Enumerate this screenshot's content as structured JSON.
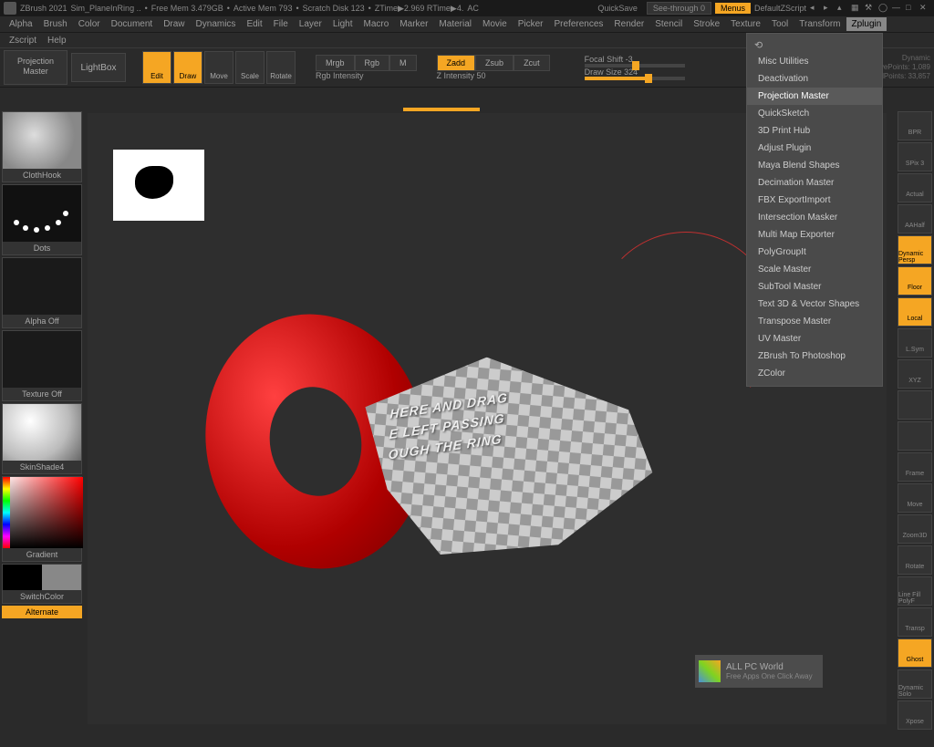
{
  "title": {
    "app": "ZBrush 2021",
    "doc": "Sim_PlaneInRing  ..",
    "mem": "Free Mem 3.479GB",
    "active": "Active Mem 793",
    "scratch": "Scratch Disk 123",
    "ztime": "ZTime▶2.969 RTime▶4.",
    "ac": "AC",
    "quicksave": "QuickSave",
    "seethrough": "See-through  0",
    "menus": "Menus",
    "script": "DefaultZScript"
  },
  "menubar": [
    "Alpha",
    "Brush",
    "Color",
    "Document",
    "Draw",
    "Dynamics",
    "Edit",
    "File",
    "Layer",
    "Light",
    "Macro",
    "Marker",
    "Material",
    "Movie",
    "Picker",
    "Preferences",
    "Render",
    "Stencil",
    "Stroke",
    "Texture",
    "Tool",
    "Transform",
    "Zplugin"
  ],
  "menubar2": [
    "Zscript",
    "Help"
  ],
  "toolrow": {
    "proj_master": "Projection\nMaster",
    "lightbox": "LightBox",
    "btns": [
      {
        "label": "Edit",
        "orange": true
      },
      {
        "label": "Draw",
        "orange": true
      },
      {
        "label": "Move",
        "orange": false
      },
      {
        "label": "Scale",
        "orange": false
      },
      {
        "label": "Rotate",
        "orange": false
      }
    ],
    "modes1": [
      {
        "t": "Mrgb"
      },
      {
        "t": "Rgb"
      },
      {
        "t": "M"
      }
    ],
    "rgb_int": "Rgb Intensity",
    "modes2": [
      {
        "t": "Zadd",
        "o": true
      },
      {
        "t": "Zsub"
      },
      {
        "t": "Zcut"
      }
    ],
    "z_int": "Z Intensity 50",
    "focal": "Focal Shift -3",
    "draw_size": "Draw Size 324",
    "dynamic": "Dynamic",
    "active_pts": "ActivePoints: 1,089",
    "total_pts": "TotalPoints: 33,857"
  },
  "left": {
    "clothhook": "ClothHook",
    "dots": "Dots",
    "alpha_off": "Alpha Off",
    "texture_off": "Texture Off",
    "skinshade": "SkinShade4",
    "gradient": "Gradient",
    "switchcolor": "SwitchColor",
    "alternate": "Alternate"
  },
  "right": [
    "BPR",
    "SPix 3",
    "Actual",
    "AAHalf",
    "Dynamic Persp",
    "Floor",
    "Local",
    "L.Sym",
    "XYZ",
    "",
    "",
    "Frame",
    "Move",
    "Zoom3D",
    "Rotate",
    "Line Fill PolyF",
    "Transp",
    "Ghost",
    "Dynamic Solo",
    "Xpose"
  ],
  "right_orange": [
    4,
    5,
    6,
    17
  ],
  "dropdown": {
    "items": [
      "Misc Utilities",
      "Deactivation",
      "Projection Master",
      "QuickSketch",
      "3D Print Hub",
      "Adjust Plugin",
      "Maya Blend Shapes",
      "Decimation Master",
      "FBX ExportImport",
      "Intersection Masker",
      "Multi Map Exporter",
      "PolyGroupIt",
      "Scale Master",
      "SubTool Master",
      "Text 3D & Vector Shapes",
      "Transpose Master",
      "UV Master",
      "ZBrush To Photoshop",
      "ZColor"
    ],
    "highlight": 2
  },
  "cloth_text": [
    "HERE AND DRAG",
    "E LEFT PASSING",
    "OUGH THE RING"
  ],
  "watermark": {
    "title": "ALL PC World",
    "sub": "Free Apps One Click Away"
  }
}
